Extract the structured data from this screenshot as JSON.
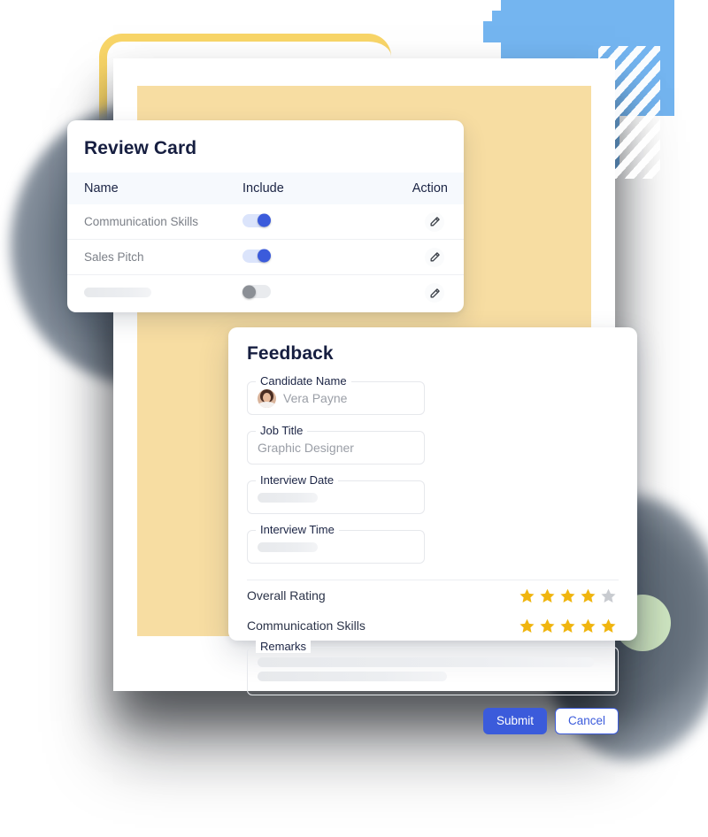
{
  "decorations": {
    "blue_block_color": "#74b5f0",
    "yellow_arc_color": "#f8d568",
    "green_circle_color": "#cfe6c2",
    "yellow_panel_color": "#f7dda2",
    "gray_blob_color": "#6b7785"
  },
  "review_card": {
    "title": "Review Card",
    "columns": [
      "Name",
      "Include",
      "Action"
    ],
    "rows": [
      {
        "name": "Communication Skills",
        "include": true,
        "is_placeholder": false,
        "action_icon": "pencil-icon"
      },
      {
        "name": "Sales Pitch",
        "include": true,
        "is_placeholder": false,
        "action_icon": "pencil-icon"
      },
      {
        "name": "",
        "include": false,
        "is_placeholder": true,
        "action_icon": "pencil-icon"
      }
    ]
  },
  "feedback_card": {
    "title": "Feedback",
    "fields": [
      {
        "label": "Candidate Name",
        "value": "Vera Payne",
        "has_avatar": true,
        "is_placeholder": false
      },
      {
        "label": "Job Title",
        "value": "Graphic Designer",
        "has_avatar": false,
        "is_placeholder": false
      },
      {
        "label": "Interview Date",
        "value": "",
        "has_avatar": false,
        "is_placeholder": true
      },
      {
        "label": "Interview Time",
        "value": "",
        "has_avatar": false,
        "is_placeholder": true
      }
    ],
    "ratings": [
      {
        "label": "Overall Rating",
        "filled": 4,
        "total": 5
      },
      {
        "label": "Communication Skills",
        "filled": 5,
        "total": 5
      }
    ],
    "remarks": {
      "label": "Remarks",
      "value": ""
    },
    "buttons": {
      "submit": "Submit",
      "cancel": "Cancel"
    },
    "colors": {
      "primary": "#3b5bdb",
      "star_filled": "#f0b50f",
      "star_empty": "#c8cbd0",
      "title": "#161e40"
    }
  }
}
